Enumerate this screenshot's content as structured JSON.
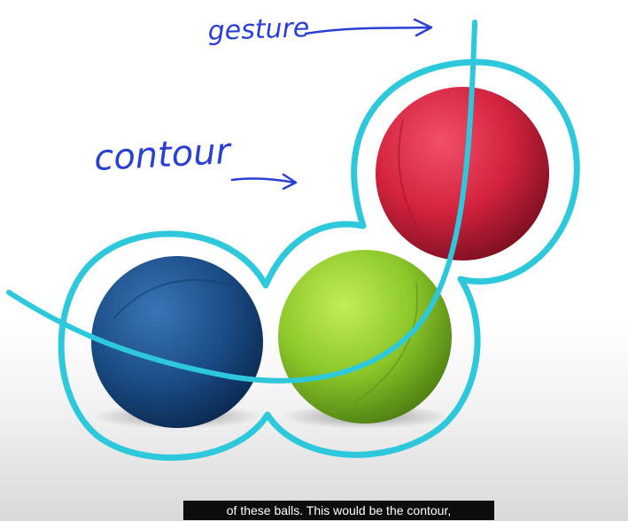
{
  "annotations": {
    "gesture_label": "gesture",
    "contour_label": "contour"
  },
  "balls": [
    {
      "name": "red",
      "color": "#d4233f"
    },
    {
      "name": "blue",
      "color": "#1c4f8a"
    },
    {
      "name": "green",
      "color": "#8cc72a"
    }
  ],
  "colors": {
    "contour": "#2ec8dd",
    "ink": "#2a3fd6"
  },
  "caption": {
    "text": "of these balls. This would be the contour,"
  }
}
